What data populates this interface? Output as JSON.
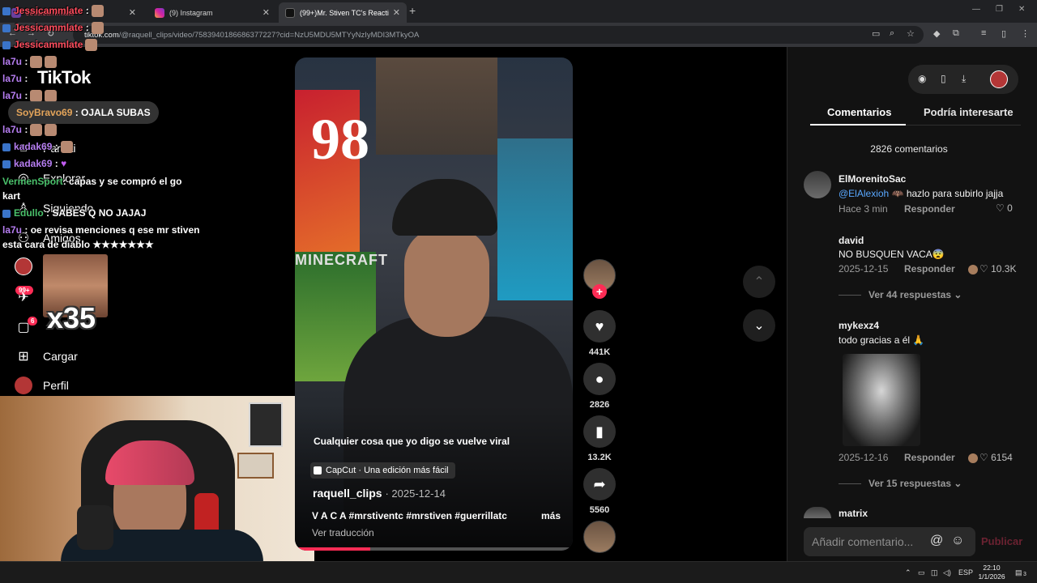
{
  "browser": {
    "tabs": [
      {
        "label": "Jessicammlate",
        "active": false
      },
      {
        "label": "(9) Instagram",
        "active": false
      },
      {
        "label": "(99+)Mr. Stiven TC's Reaction to",
        "active": true
      }
    ],
    "url_host": "tiktok.com",
    "url_path": "/@raquell_clips/video/7583940186686377227?cid=NzU5MDU5MTYyNzIyMDI3MTkyOA"
  },
  "tiktok": {
    "logo": "TikTok",
    "nav": [
      {
        "label": "Para ti",
        "icon": "home-icon"
      },
      {
        "label": "Explorar",
        "icon": "compass-icon"
      },
      {
        "label": "Siguiendo",
        "icon": "following-icon"
      },
      {
        "label": "Amigos",
        "icon": "friends-icon"
      },
      {
        "label": "LIVE",
        "icon": "live-icon"
      },
      {
        "label": "Mensajes",
        "icon": "messages-icon"
      },
      {
        "label": "Actividad",
        "icon": "activity-icon"
      },
      {
        "label": "Cargar",
        "icon": "upload-icon"
      },
      {
        "label": "Perfil",
        "icon": "profile-icon"
      }
    ],
    "badges": {
      "messages": "99+",
      "activity": "6"
    }
  },
  "chat": {
    "pinned": {
      "user": "SoyBravo69",
      "text": "OJALA SUBAS"
    },
    "lines": [
      {
        "user": "Jessicammlate",
        "text": ":",
        "color": "r"
      },
      {
        "user": "Jessicammlate",
        "text": ":",
        "color": "r"
      },
      {
        "user": "Jessicammlate",
        "text": "",
        "color": "r"
      },
      {
        "user": "la7u",
        "text": ":",
        "color": "u"
      },
      {
        "user": "la7u",
        "text": ":",
        "color": "u"
      },
      {
        "user": "la7u",
        "text": ":",
        "color": "u"
      },
      {
        "user": "la7u",
        "text": ":",
        "color": "u"
      },
      {
        "user": "kadak69",
        "text": ":",
        "color": "u"
      },
      {
        "user": "kadak69",
        "text": ":",
        "color": "u"
      },
      {
        "user": "VermenSport",
        "text": ": capas y se compró el go",
        "color": "g"
      },
      {
        "user": "",
        "text": "kart",
        "color": "u"
      },
      {
        "user": "Edullo",
        "text": ": SABES Q NO JAJAJ",
        "color": "g"
      },
      {
        "user": "la7u",
        "text": ": oe revisa menciones q ese mr stiven",
        "color": "u"
      },
      {
        "user": "",
        "text": "esta cara de diablo ★★★★★★★",
        "color": "u"
      }
    ],
    "meme_multiplier": "x35"
  },
  "video": {
    "caption": "Cualquier cosa que yo digo se vuelve viral",
    "capcut": "CapCut · Una edición más fácil",
    "author": "raquell_clips",
    "date": "· 2025-12-14",
    "tags": "V A C A #mrstiventc #mrstiven #guerrillatc ...",
    "more": "más",
    "translate": "Ver traducción",
    "progress": 0.27
  },
  "actions": {
    "likes": "441K",
    "comments": "2826",
    "saves": "13.2K",
    "shares": "5560"
  },
  "comments_panel": {
    "tabs": [
      "Comentarios",
      "Podría interesarte"
    ],
    "count_label": "2826 comentarios",
    "reply_label": "Responder",
    "comments": [
      {
        "user": "ElMorenitoSac",
        "mention": "@ElAlexioh",
        "text": "🦇 hazlo para subirlo jajja",
        "date": "Hace 3 min",
        "likes": "0",
        "creator_liked": false
      },
      {
        "user": "david",
        "mention": "",
        "text": "NO BUSQUEN VACA😨",
        "date": "2025-12-15",
        "likes": "10.3K",
        "creator_liked": true,
        "more": "Ver 44 respuestas"
      },
      {
        "user": "mykexz4",
        "mention": "",
        "text": "todo gracias a él 🙏",
        "date": "2025-12-16",
        "likes": "6154",
        "creator_liked": true,
        "more": "Ver 15 respuestas"
      },
      {
        "user": "matrix",
        "mention": "",
        "text": "",
        "date": "",
        "likes": "",
        "creator_liked": false
      }
    ],
    "input_placeholder": "Añadir comentario...",
    "post_label": "Publicar"
  },
  "taskbar": {
    "lang": "ESP",
    "time": "22:10",
    "date": "1/1/2026",
    "notif": "3"
  },
  "colors": {
    "accent": "#fe2c55",
    "mention": "#59a8ff",
    "panel_bg": "#121212"
  }
}
